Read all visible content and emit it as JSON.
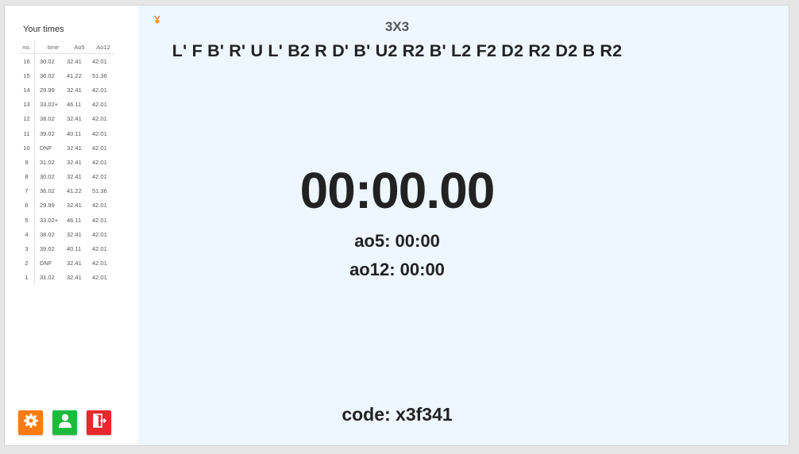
{
  "sidebar": {
    "title": "Your times",
    "columns": [
      "no.",
      "time",
      "Ao5",
      "Ao12"
    ],
    "rows": [
      [
        "16",
        "30.02",
        "32.41",
        "42.01"
      ],
      [
        "15",
        "36.02",
        "41.22",
        "51.36"
      ],
      [
        "14",
        "29.99",
        "32.41",
        "42.01"
      ],
      [
        "13",
        "33.02+",
        "46.11",
        "42.01"
      ],
      [
        "12",
        "38.02",
        "32.41",
        "42.01"
      ],
      [
        "11",
        "39.02",
        "40.11",
        "42.01"
      ],
      [
        "10",
        "DNF",
        "32.41",
        "42.01"
      ],
      [
        "9",
        "31.02",
        "32.41",
        "42.01"
      ],
      [
        "8",
        "30.02",
        "32.41",
        "42.01"
      ],
      [
        "7",
        "36.02",
        "41.22",
        "51.36"
      ],
      [
        "6",
        "29.99",
        "32.41",
        "42.01"
      ],
      [
        "5",
        "33.02+",
        "46.11",
        "42.01"
      ],
      [
        "4",
        "38.02",
        "32.41",
        "42.01"
      ],
      [
        "3",
        "39.02",
        "40.11",
        "42.01"
      ],
      [
        "2",
        "DNF",
        "32.41",
        "42.01"
      ],
      [
        "1",
        "31.02",
        "32.41",
        "42.01"
      ]
    ],
    "buttons": {
      "settings": {
        "icon": "gear-icon",
        "color": "#ff7b0f"
      },
      "profile": {
        "icon": "user-icon",
        "color": "#1dbb3c"
      },
      "logout": {
        "icon": "logout-icon",
        "color": "#e8282b"
      }
    }
  },
  "main": {
    "medal_icon": "medal-icon",
    "puzzle": "3X3",
    "scramble": "L' F B' R' U L' B2 R D' B' U2 R2 B' L2 F2 D2 R2 D2 B R2",
    "timer": "00:00.00",
    "ao5": "ao5: 00:00",
    "ao12": "ao12: 00:00",
    "code": "code: x3f341"
  },
  "colors": {
    "main_background": "#eef6ff",
    "sidebar_background": "#ffffff",
    "text": "#222222"
  }
}
